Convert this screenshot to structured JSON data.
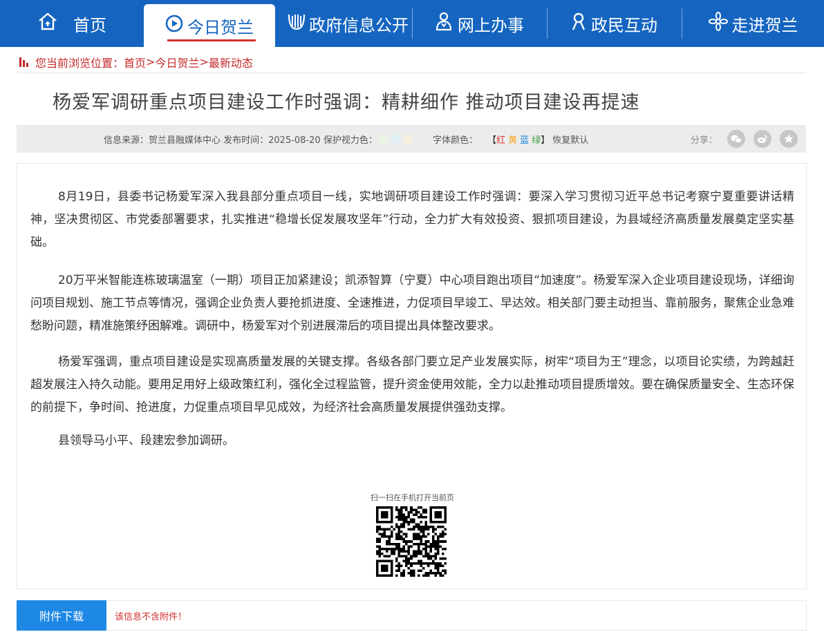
{
  "nav": {
    "items": [
      {
        "label": "首页",
        "icon": "home-icon"
      },
      {
        "label": "今日贺兰",
        "icon": "compass-icon",
        "active": true
      },
      {
        "label": "政府信息公开",
        "icon": "building-icon"
      },
      {
        "label": "网上办事",
        "icon": "service-icon"
      },
      {
        "label": "政民互动",
        "icon": "user-icon"
      },
      {
        "label": "走进贺兰",
        "icon": "flower-icon"
      }
    ]
  },
  "breadcrumb": {
    "prefix": "您当前浏览位置：",
    "items": [
      "首页",
      "今日贺兰",
      "最新动态"
    ],
    "separator": ">"
  },
  "article": {
    "title": "杨爱军调研重点项目建设工作时强调：精耕细作 推动项目建设再提速",
    "meta": {
      "source": "信息来源：贺兰县融媒体中心 发布时间：2025-08-20 保护视力色：",
      "font_color_label": "字体颜色：",
      "font_colors": [
        {
          "label": "红",
          "color": "#e53935"
        },
        {
          "label": "黄",
          "color": "#f9a825"
        },
        {
          "label": "蓝",
          "color": "#1e88e5"
        },
        {
          "label": "绿",
          "color": "#43a047"
        }
      ],
      "bracket_open": "【",
      "bracket_close": "】",
      "reset": "恢复默认",
      "eye_colors": [
        "#e8f5e0",
        "#e0f0f5",
        "#f8f2dc"
      ],
      "share_label": "分享："
    },
    "paragraphs": [
      "8月19日，县委书记杨爱军深入我县部分重点项目一线，实地调研项目建设工作时强调：要深入学习贯彻习近平总书记考察宁夏重要讲话精神，坚决贯彻区、市党委部署要求，扎实推进“稳增长促发展攻坚年”行动，全力扩大有效投资、狠抓项目建设，为县域经济高质量发展奠定坚实基础。",
      "20万平米智能连栋玻璃温室（一期）项目正加紧建设；凯添智算（宁夏）中心项目跑出项目“加速度”。杨爱军深入企业项目建设现场，详细询问项目规划、施工节点等情况，强调企业负责人要抢抓进度、全速推进，力促项目早竣工、早达效。相关部门要主动担当、靠前服务，聚焦企业急难愁盼问题，精准施策纾困解难。调研中，杨爱军对个别进展滞后的项目提出具体整改要求。",
      "杨爱军强调，重点项目建设是实现高质量发展的关键支撑。各级各部门要立足产业发展实际，树牢“项目为王”理念，以项目论实绩，为跨越赶超发展注入持久动能。要用足用好上级政策红利，强化全过程监管，提升资金使用效能，全力以赴推动项目提质增效。要在确保质量安全、生态环保的前提下，争时间、抢进度，力促重点项目早见成效，为经济社会高质量发展提供强劲支撑。",
      "县领导马小平、段建宏参加调研。"
    ],
    "qr_label": "扫一扫在手机打开当前页"
  },
  "attachment": {
    "button": "附件下载",
    "message": "该信息不含附件！"
  },
  "colors": {
    "nav_bg": "#1565c0",
    "accent_red": "#c62828",
    "attach_btn": "#1e88e5"
  }
}
